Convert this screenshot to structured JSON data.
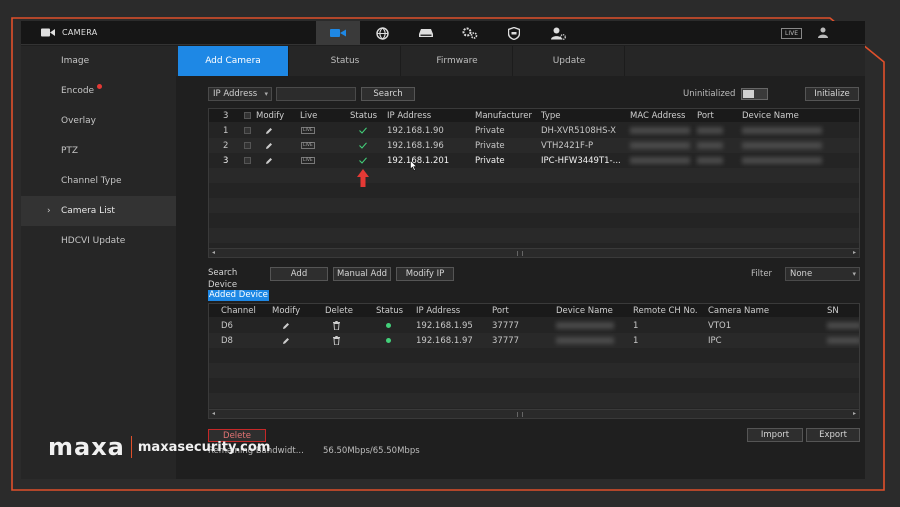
{
  "app": {
    "title": "CAMERA",
    "live_badge": "LIVE"
  },
  "top_icons": [
    "camera-icon",
    "network-icon",
    "storage-icon",
    "system-settings-icon",
    "security-shield-icon",
    "account-icon"
  ],
  "sidebar": {
    "items": [
      {
        "label": "Image"
      },
      {
        "label": "Encode"
      },
      {
        "label": "Overlay"
      },
      {
        "label": "PTZ"
      },
      {
        "label": "Channel Type"
      },
      {
        "label": "Camera List",
        "chevron": "›"
      },
      {
        "label": "HDCVI Update"
      }
    ]
  },
  "tabs": [
    {
      "label": "Add Camera"
    },
    {
      "label": "Status"
    },
    {
      "label": "Firmware"
    },
    {
      "label": "Update"
    }
  ],
  "search": {
    "protocol": "IP Address",
    "dropdown_arrow": "▾",
    "search_label": "Search",
    "uninitialized_label": "Uninitialized",
    "initialize_label": "Initialize"
  },
  "found_table": {
    "headers": {
      "count": "3",
      "modify": "Modify",
      "live": "Live",
      "status": "Status",
      "ip": "IP Address",
      "manufacturer": "Manufacturer",
      "type": "Type",
      "mac": "MAC Address",
      "port": "Port",
      "device_name": "Device Name"
    },
    "rows": [
      {
        "num": "1",
        "live": "LIVE",
        "ip": "192.168.1.90",
        "manufacturer": "Private",
        "type": "DH-XVR5108HS-X"
      },
      {
        "num": "2",
        "live": "LIVE",
        "ip": "192.168.1.96",
        "manufacturer": "Private",
        "type": "VTH2421F-P"
      },
      {
        "num": "3",
        "live": "LIVE",
        "ip": "192.168.1.201",
        "manufacturer": "Private",
        "type": "IPC-HFW3449T1-..."
      }
    ],
    "scroll_left": "◂",
    "scroll_right": "▸"
  },
  "actions": {
    "search_device": "Search Device",
    "add": "Add",
    "manual_add": "Manual Add",
    "modify_ip": "Modify IP",
    "filter_label": "Filter",
    "filter_value": "None",
    "filter_arrow": "▾"
  },
  "added_table": {
    "tag": "Added Device",
    "headers": {
      "channel": "Channel",
      "modify": "Modify",
      "delete": "Delete",
      "status": "Status",
      "ip": "IP Address",
      "port": "Port",
      "device_name": "Device Name",
      "remote_ch": "Remote CH No.",
      "camera_name": "Camera Name",
      "sn": "SN"
    },
    "rows": [
      {
        "channel": "D6",
        "ip": "192.168.1.95",
        "port": "37777",
        "remote_ch": "1",
        "camera_name": "VTO1"
      },
      {
        "channel": "D8",
        "ip": "192.168.1.97",
        "port": "37777",
        "remote_ch": "1",
        "camera_name": "IPC"
      }
    ],
    "scroll_left": "◂",
    "scroll_right": "▸"
  },
  "footer": {
    "delete_label": "Delete",
    "import_label": "Import",
    "export_label": "Export",
    "bandwidth_label": "Remaining Bandwidt...",
    "bandwidth_value": "56.50Mbps/65.50Mbps"
  },
  "watermark": {
    "logo": "maxa",
    "site": "maxasecurity.com"
  },
  "colors": {
    "accent": "#1e88e5",
    "frame_border": "#e0502b",
    "status_ok": "#43d17a",
    "arrow": "#e53935"
  }
}
